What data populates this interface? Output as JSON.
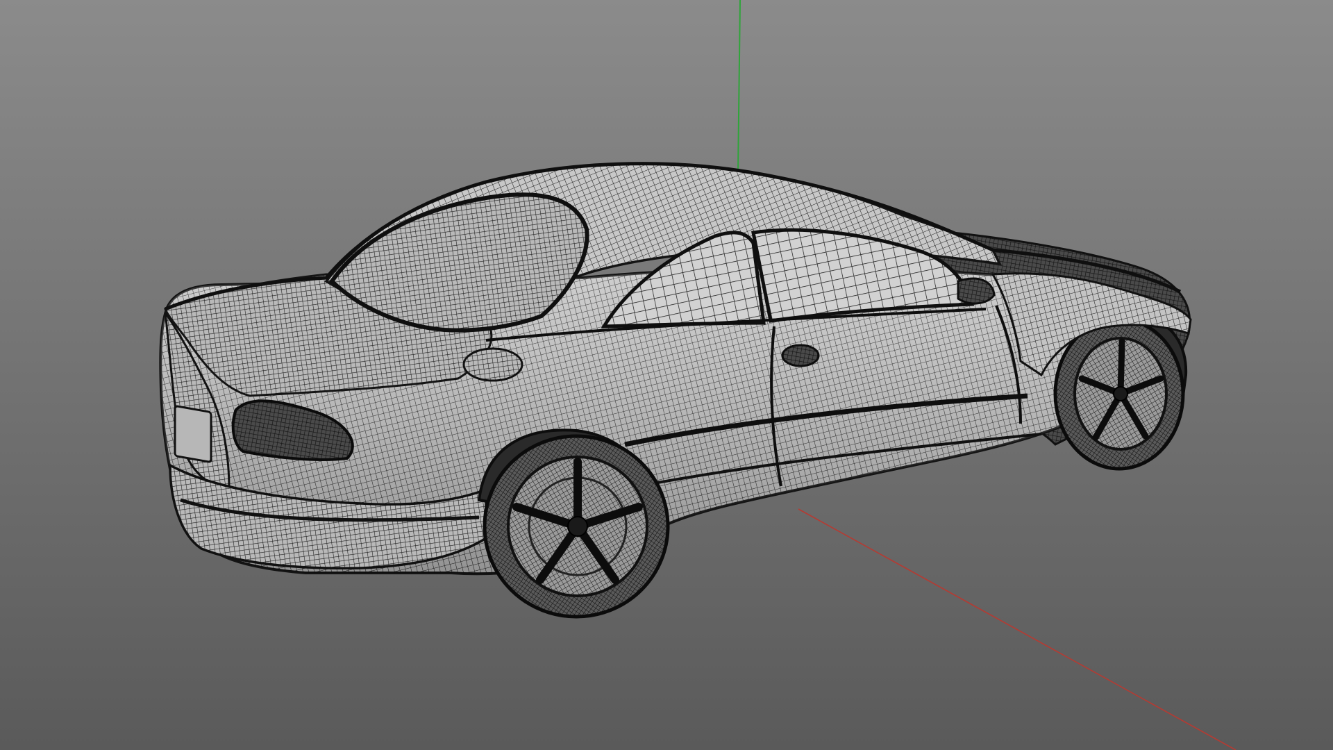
{
  "viewport": {
    "background_top": "#8b8b8b",
    "background_bottom": "#5a5a5a"
  },
  "axes": {
    "y_axis_color": "#2fa53a",
    "x_axis_color": "#b63a32"
  },
  "model": {
    "render_mode": "wireframe",
    "object": "car",
    "wire_color": "#1c1c1c",
    "surface_light": "#cfcfcf",
    "surface_mid": "#9a9a9a",
    "surface_dark": "#3a3a3a"
  }
}
